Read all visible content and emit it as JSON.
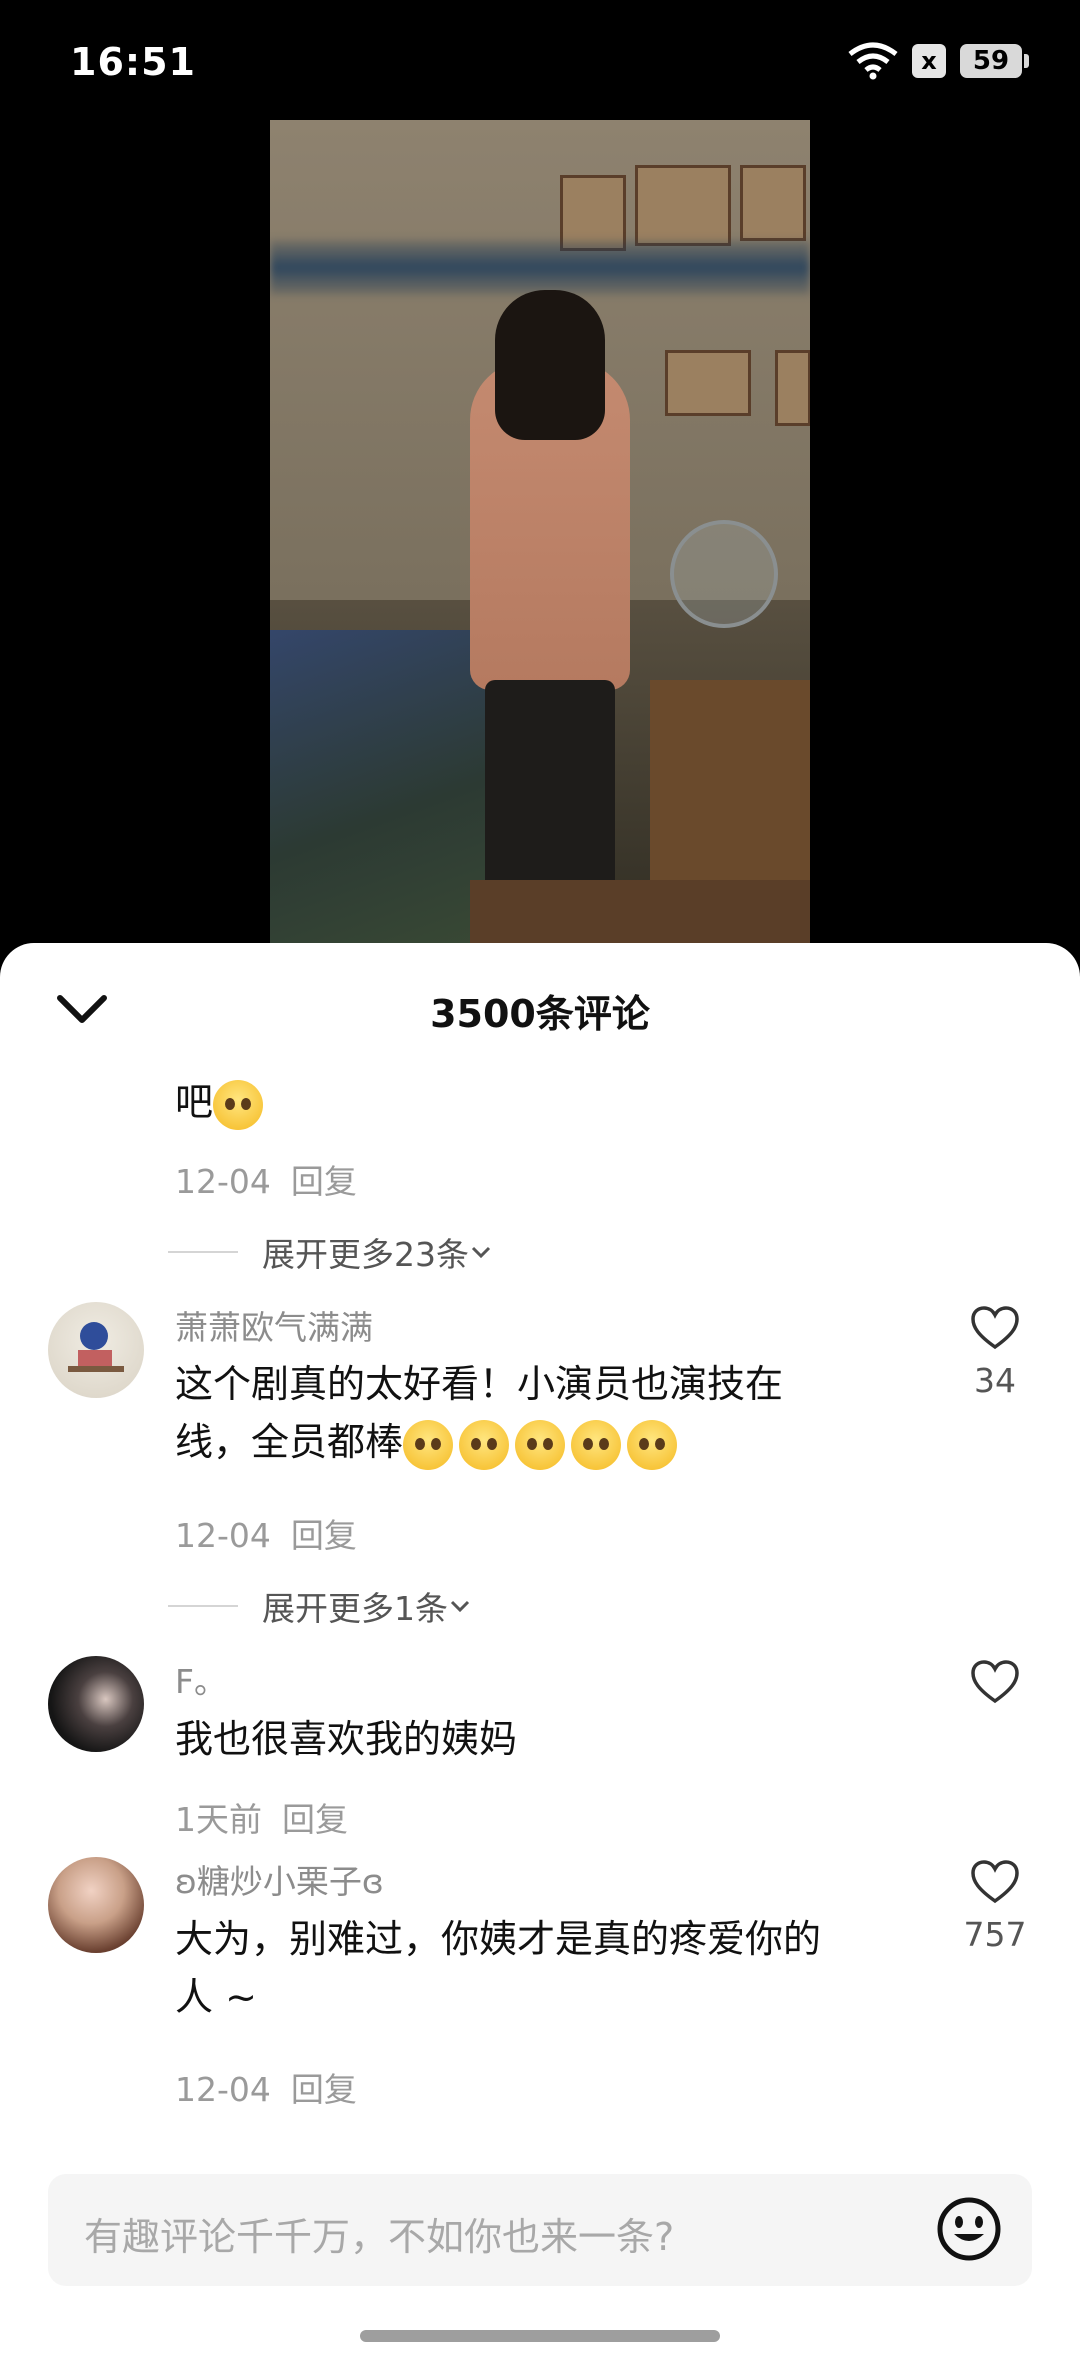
{
  "status_bar": {
    "time": "16:51",
    "battery": "59",
    "x_label": "x"
  },
  "header": {
    "title": "3500条评论"
  },
  "comments": [
    {
      "text": "吧",
      "date": "12-04",
      "reply": "回复"
    },
    {
      "username": "萧萧欧气满满",
      "text_line1": "这个剧真的太好看！小演员也演技在",
      "text_line2": "线，全员都棒",
      "date": "12-04",
      "reply": "回复",
      "likes": "34"
    },
    {
      "username": "F。",
      "text": "我也很喜欢我的姨妈",
      "date": "1天前",
      "reply": "回复"
    },
    {
      "username": "ʚ糖炒小栗子ɞ",
      "text_line1": "大为，别难过，你姨才是真的疼爱你的",
      "text_line2": "人 ~",
      "date": "12-04",
      "reply": "回复",
      "likes": "757"
    }
  ],
  "expanders": [
    "展开更多23条",
    "展开更多1条"
  ],
  "input": {
    "placeholder": "有趣评论千千万，不如你也来一条?"
  },
  "icons": [
    "wifi-icon",
    "close-box-icon",
    "battery-icon",
    "chevron-down-icon",
    "heart-icon",
    "smile-icon"
  ]
}
